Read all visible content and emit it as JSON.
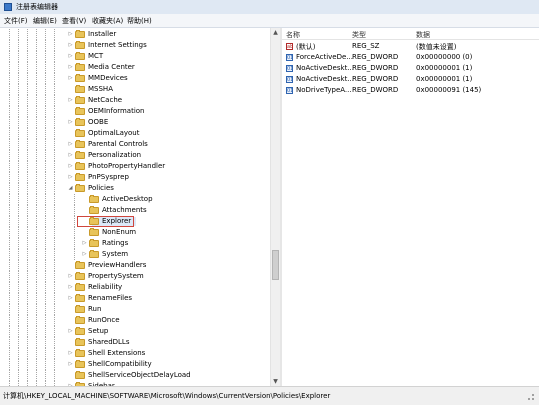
{
  "window": {
    "title": "注册表编辑器"
  },
  "menu": [
    "文件(F)",
    "编辑(E)",
    "查看(V)",
    "收藏夹(A)",
    "帮助(H)"
  ],
  "tree": {
    "selected": "Explorer",
    "items": [
      {
        "label": "Installer",
        "depth": 0,
        "expander": "closed"
      },
      {
        "label": "Internet Settings",
        "depth": 0,
        "expander": "closed"
      },
      {
        "label": "MCT",
        "depth": 0,
        "expander": "closed"
      },
      {
        "label": "Media Center",
        "depth": 0,
        "expander": "closed"
      },
      {
        "label": "MMDevices",
        "depth": 0,
        "expander": "closed"
      },
      {
        "label": "MSSHA",
        "depth": 0,
        "expander": "none"
      },
      {
        "label": "NetCache",
        "depth": 0,
        "expander": "closed"
      },
      {
        "label": "OEMInformation",
        "depth": 0,
        "expander": "none"
      },
      {
        "label": "OOBE",
        "depth": 0,
        "expander": "closed"
      },
      {
        "label": "OptimalLayout",
        "depth": 0,
        "expander": "none"
      },
      {
        "label": "Parental Controls",
        "depth": 0,
        "expander": "closed"
      },
      {
        "label": "Personalization",
        "depth": 0,
        "expander": "closed"
      },
      {
        "label": "PhotoPropertyHandler",
        "depth": 0,
        "expander": "closed"
      },
      {
        "label": "PnPSysprep",
        "depth": 0,
        "expander": "closed"
      },
      {
        "label": "Policies",
        "depth": 0,
        "expander": "open"
      },
      {
        "label": "ActiveDesktop",
        "depth": 1,
        "expander": "none"
      },
      {
        "label": "Attachments",
        "depth": 1,
        "expander": "none"
      },
      {
        "label": "Explorer",
        "depth": 1,
        "expander": "none"
      },
      {
        "label": "NonEnum",
        "depth": 1,
        "expander": "none"
      },
      {
        "label": "Ratings",
        "depth": 1,
        "expander": "closed"
      },
      {
        "label": "System",
        "depth": 1,
        "expander": "closed"
      },
      {
        "label": "PreviewHandlers",
        "depth": 0,
        "expander": "none"
      },
      {
        "label": "PropertySystem",
        "depth": 0,
        "expander": "closed"
      },
      {
        "label": "Reliability",
        "depth": 0,
        "expander": "closed"
      },
      {
        "label": "RenameFiles",
        "depth": 0,
        "expander": "closed"
      },
      {
        "label": "Run",
        "depth": 0,
        "expander": "none"
      },
      {
        "label": "RunOnce",
        "depth": 0,
        "expander": "none"
      },
      {
        "label": "Setup",
        "depth": 0,
        "expander": "closed"
      },
      {
        "label": "SharedDLLs",
        "depth": 0,
        "expander": "none"
      },
      {
        "label": "Shell Extensions",
        "depth": 0,
        "expander": "closed"
      },
      {
        "label": "ShellCompatibility",
        "depth": 0,
        "expander": "closed"
      },
      {
        "label": "ShellServiceObjectDelayLoad",
        "depth": 0,
        "expander": "none"
      },
      {
        "label": "Sidebar",
        "depth": 0,
        "expander": "closed"
      }
    ]
  },
  "columns": {
    "name": "名称",
    "type": "类型",
    "data": "数据"
  },
  "values": [
    {
      "name": "(默认)",
      "type": "REG_SZ",
      "data": "(数值未设置)",
      "icon": "string-value-icon"
    },
    {
      "name": "ForceActiveDe...",
      "type": "REG_DWORD",
      "data": "0x00000000 (0)",
      "icon": "dword-value-icon"
    },
    {
      "name": "NoActiveDeskt...",
      "type": "REG_DWORD",
      "data": "0x00000001 (1)",
      "icon": "dword-value-icon"
    },
    {
      "name": "NoActiveDeskt...",
      "type": "REG_DWORD",
      "data": "0x00000001 (1)",
      "icon": "dword-value-icon"
    },
    {
      "name": "NoDriveTypeA...",
      "type": "REG_DWORD",
      "data": "0x00000091 (145)",
      "icon": "dword-value-icon"
    }
  ],
  "statusbar": {
    "path": "计算机\\HKEY_LOCAL_MACHINE\\SOFTWARE\\Microsoft\\Windows\\CurrentVersion\\Policies\\Explorer"
  },
  "colors": {
    "folder": "#e8c45a",
    "selection_border": "#d0463d",
    "titlebar": "#dfe8f3"
  }
}
